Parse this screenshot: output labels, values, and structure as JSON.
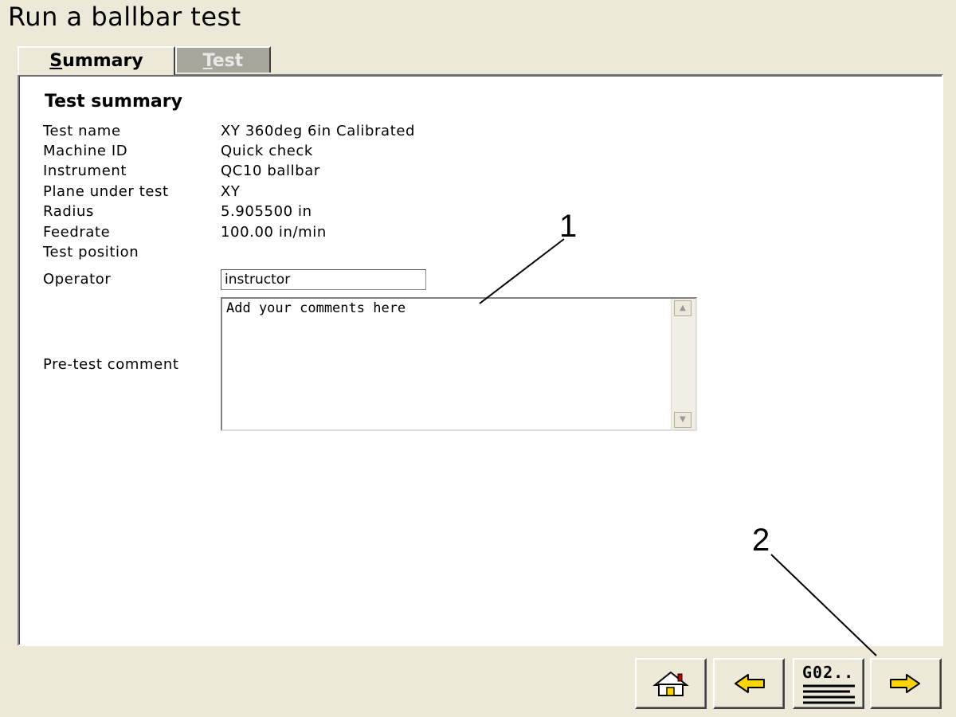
{
  "window": {
    "title": "Run a ballbar test"
  },
  "tabs": [
    {
      "label": "Summary",
      "active": true
    },
    {
      "label": "Test",
      "active": false
    }
  ],
  "summary": {
    "section_title": "Test summary",
    "rows": [
      {
        "label": "Test name",
        "value": "XY 360deg 6in Calibrated"
      },
      {
        "label": "Machine ID",
        "value": "Quick check"
      },
      {
        "label": "Instrument",
        "value": "QC10 ballbar"
      },
      {
        "label": "Plane under test",
        "value": "XY"
      },
      {
        "label": "Radius",
        "value": "5.905500 in"
      },
      {
        "label": "Feedrate",
        "value": "100.00 in/min"
      },
      {
        "label": "Test position",
        "value": ""
      }
    ],
    "operator_label": "Operator",
    "operator_value": "instructor",
    "comment_label": "Pre-test comment",
    "comment_value": "Add your comments here"
  },
  "callouts": [
    "1",
    "2"
  ],
  "toolbar": {
    "home_icon": "home-icon",
    "back_icon": "arrow-left-icon",
    "gcode_label": "G02..",
    "next_icon": "arrow-right-icon"
  },
  "colors": {
    "window_bg": "#ece9d8",
    "arrow_fill": "#ffd400",
    "inactive_tab": "#a8a69c"
  }
}
